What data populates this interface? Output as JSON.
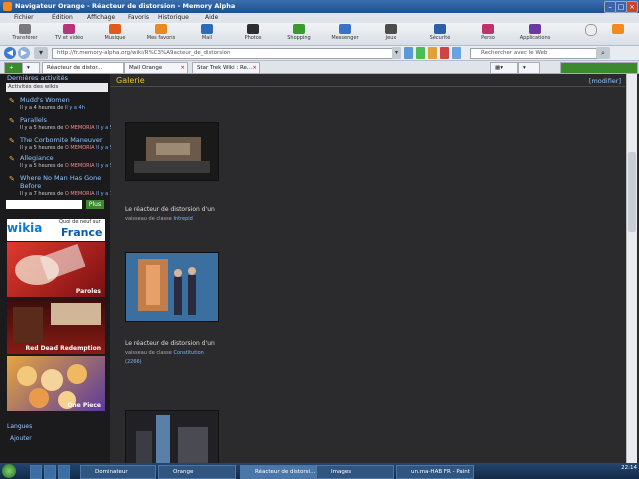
{
  "window": {
    "title": "Navigateur Orange - Réacteur de distorsion - Memory Alpha"
  },
  "menu": [
    "Fichier",
    "Édition",
    "Affichage",
    "Favoris",
    "Historique",
    "Aide"
  ],
  "toolbar": {
    "buttons": [
      {
        "label": "Transférer",
        "color": "#7a7a7a"
      },
      {
        "label": "TV et vidéo",
        "color": "#b7337a"
      },
      {
        "label": "Musique",
        "color": "#e25b1a"
      },
      {
        "label": "Mes favoris",
        "color": "#e88a20"
      },
      {
        "label": "Mail",
        "color": "#2d6ab8"
      },
      {
        "label": "Photos",
        "color": "#2e2e2e"
      },
      {
        "label": "Shopping",
        "color": "#3b9a2e"
      },
      {
        "label": "Messenger",
        "color": "#3a74c9"
      },
      {
        "label": "Jeux",
        "color": "#4c4c4c"
      },
      {
        "label": "Sécurité",
        "color": "#2d5ea8"
      },
      {
        "label": "Perso",
        "color": "#c0306b"
      },
      {
        "label": "Applications",
        "color": "#6b3aa0"
      }
    ]
  },
  "address": {
    "url": "http://fr.memory-alpha.org/wiki/R%C3%A9acteur_de_distorsion",
    "search_placeholder": "Rechercher avec le Web"
  },
  "tabs": [
    {
      "label": "Réacteur de distor...",
      "active": true
    },
    {
      "label": "Mail Orange",
      "active": false
    },
    {
      "label": "Star Trek Wiki : Re...",
      "active": false
    }
  ],
  "sidebar": {
    "heading": "Dernières activités",
    "selector": "Activités des wikis",
    "activities": [
      {
        "title": "Mudd's Women",
        "meta_prefix": "Il y a 4 heures de",
        "user": "",
        "suffix": "Il y a 4h"
      },
      {
        "title": "Parallels",
        "meta_prefix": "Il y a 5 heures de",
        "user": "O MEMORIA",
        "suffix": "Il y a 5h"
      },
      {
        "title": "The Corbomite Maneuver",
        "meta_prefix": "Il y a 5 heures de",
        "user": "O MEMORIA",
        "suffix": "Il y a 5h"
      },
      {
        "title": "Allegiance",
        "meta_prefix": "Il y a 5 heures de",
        "user": "O MEMORIA",
        "suffix": "Il y a 5h"
      },
      {
        "title": "Where No Man Has Gone",
        "title2": "Before",
        "meta_prefix": "Il y a 7 heures de",
        "user": "O MEMORIA",
        "suffix": "Il y a 7h"
      }
    ],
    "more_button": "Plus",
    "wikia": {
      "logo": "wikia",
      "question": "Quoi de neuf sur",
      "country": "France"
    },
    "banners": [
      {
        "caption": "Paroles",
        "bg": "#c4262a"
      },
      {
        "caption": "Red Dead Redemption",
        "bg": "#6a1010"
      },
      {
        "caption": "One Piece",
        "bg": "#d28b3a"
      }
    ],
    "languages_heading": "Langues",
    "language_item": "Ajouter"
  },
  "main": {
    "heading": "Galerie",
    "edit": "[modifier]",
    "gallery": [
      {
        "caption": "Le réacteur de distorsion d'un",
        "caption2_prefix": "vaisseau de classe",
        "link": "Intrepid"
      },
      {
        "caption": "Le réacteur de distorsion d'un",
        "caption2_prefix": "vaisseau de classe",
        "link": "Constitution",
        "extra": "(2266)"
      },
      {
        "caption": "",
        "caption2_prefix": "",
        "link": ""
      }
    ]
  },
  "taskbar": {
    "items": [
      "Dominateur",
      "Orange",
      "Réacteur de distorsi...",
      "Images",
      "un.ma-HAB FR - Paint"
    ],
    "time": "22:14"
  }
}
